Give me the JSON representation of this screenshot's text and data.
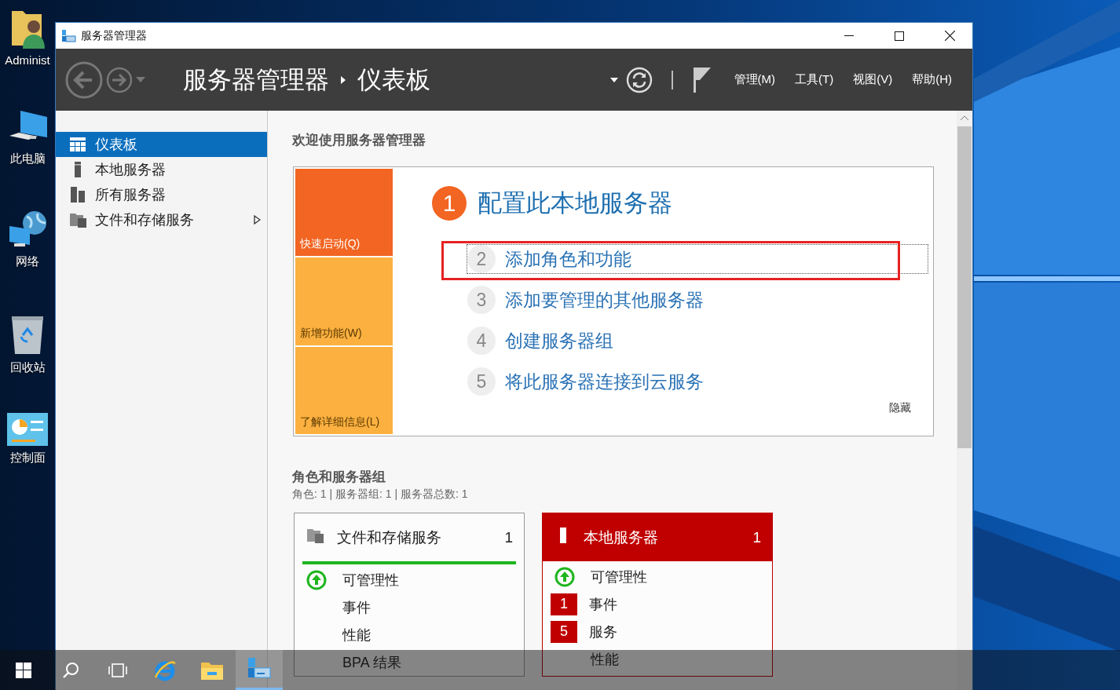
{
  "desktop": {
    "icons": [
      {
        "label": "Administ",
        "kind": "user"
      },
      {
        "label": "此电脑",
        "kind": "computer"
      },
      {
        "label": "网络",
        "kind": "network"
      },
      {
        "label": "回收站",
        "kind": "recycle"
      },
      {
        "label": "控制面",
        "kind": "control"
      }
    ]
  },
  "window": {
    "title": "服务器管理器"
  },
  "header": {
    "breadcrumb": [
      "服务器管理器",
      "仪表板"
    ],
    "menus": [
      "管理(M)",
      "工具(T)",
      "视图(V)",
      "帮助(H)"
    ]
  },
  "sidebar": {
    "items": [
      {
        "label": "仪表板",
        "kind": "dashboard",
        "selected": true,
        "has_children": false
      },
      {
        "label": "本地服务器",
        "kind": "server",
        "selected": false,
        "has_children": false
      },
      {
        "label": "所有服务器",
        "kind": "servers",
        "selected": false,
        "has_children": false
      },
      {
        "label": "文件和存储服务",
        "kind": "files",
        "selected": false,
        "has_children": true
      }
    ]
  },
  "welcome": {
    "title": "欢迎使用服务器管理器"
  },
  "quick_start": {
    "tabs": [
      {
        "label": "快速启动(Q)",
        "selected": true
      },
      {
        "label": "新增功能(W)",
        "selected": false
      },
      {
        "label": "了解详细信息(L)",
        "selected": false
      }
    ],
    "heading": {
      "number": "1",
      "text": "配置此本地服务器"
    },
    "steps": [
      {
        "number": "2",
        "text": "添加角色和功能",
        "focused": true,
        "marked": true
      },
      {
        "number": "3",
        "text": "添加要管理的其他服务器",
        "focused": false,
        "marked": false
      },
      {
        "number": "4",
        "text": "创建服务器组",
        "focused": false,
        "marked": false
      },
      {
        "number": "5",
        "text": "将此服务器连接到云服务",
        "focused": false,
        "marked": false
      }
    ],
    "hide_link": "隐藏"
  },
  "roles": {
    "title": "角色和服务器组",
    "summary": "角色: 1 | 服务器组: 1 | 服务器总数: 1",
    "tiles": [
      {
        "title": "文件和存储服务",
        "kind": "files",
        "count": "1",
        "alert": false,
        "rows": [
          {
            "kind": "status",
            "label": "可管理性"
          },
          {
            "kind": "plain",
            "label": "事件"
          },
          {
            "kind": "plain",
            "label": "性能"
          },
          {
            "kind": "plain",
            "label": "BPA 结果"
          }
        ]
      },
      {
        "title": "本地服务器",
        "kind": "server",
        "count": "1",
        "alert": true,
        "rows": [
          {
            "kind": "status",
            "label": "可管理性"
          },
          {
            "kind": "count",
            "count": "1",
            "label": "事件"
          },
          {
            "kind": "count",
            "count": "5",
            "label": "服务"
          },
          {
            "kind": "plain",
            "label": "性能"
          }
        ]
      }
    ]
  },
  "taskbar": {
    "apps": [
      {
        "kind": "start",
        "active": false
      },
      {
        "kind": "search",
        "active": false
      },
      {
        "kind": "taskview",
        "active": false
      },
      {
        "kind": "browser",
        "active": false
      },
      {
        "kind": "explorer",
        "active": false
      },
      {
        "kind": "servermanager",
        "active": true
      }
    ]
  }
}
